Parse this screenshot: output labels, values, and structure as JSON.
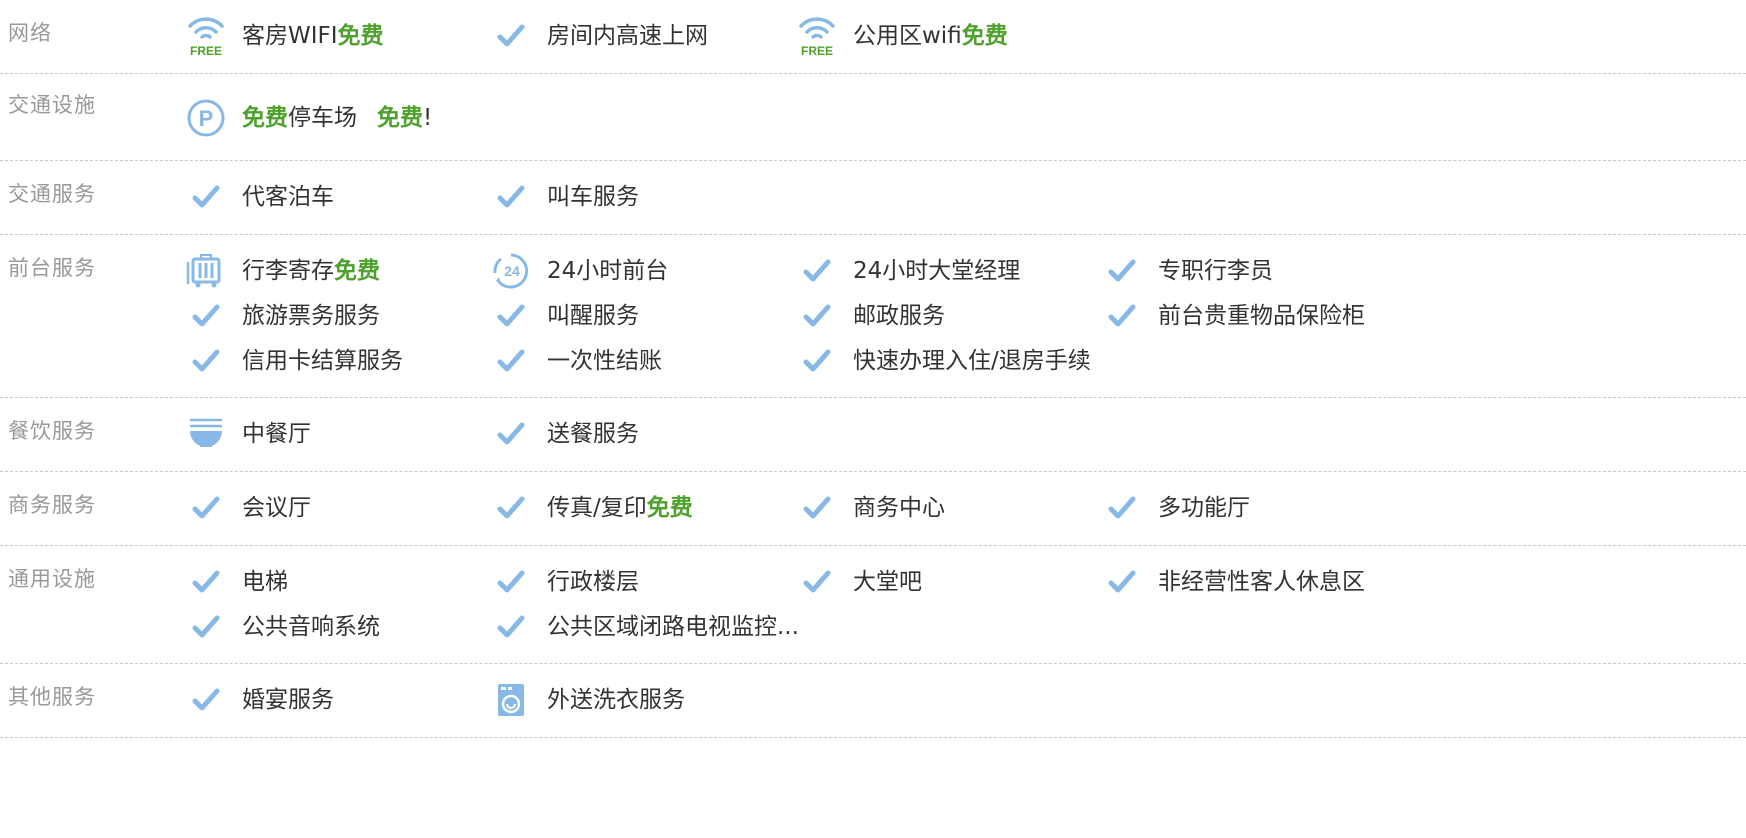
{
  "colors": {
    "accent_blue": "#88b9e6",
    "free_green": "#4ea12c",
    "category_gray": "#999999",
    "text": "#333333",
    "divider": "#c8c8c8"
  },
  "rows": [
    {
      "category": "网络",
      "items": [
        {
          "icon": "wifi-free-icon",
          "icon_text": "FREE",
          "label": "客房WIFI",
          "free": "免费"
        },
        {
          "icon": "check-icon",
          "label": "房间内高速上网"
        },
        {
          "icon": "wifi-free-icon",
          "icon_text": "FREE",
          "label": "公用区wifi",
          "free": "免费"
        }
      ]
    },
    {
      "category": "交通设施",
      "items": [
        {
          "icon": "parking-icon",
          "icon_text": "P",
          "free": "免费",
          "label": "停车场",
          "free2": "免费",
          "suffix": "!"
        }
      ]
    },
    {
      "category": "交通服务",
      "items": [
        {
          "icon": "check-icon",
          "label": "代客泊车"
        },
        {
          "icon": "check-icon",
          "label": "叫车服务"
        }
      ]
    },
    {
      "category": "前台服务",
      "items": [
        {
          "icon": "luggage-icon",
          "label": "行李寄存",
          "free": "免费"
        },
        {
          "icon": "24h-icon",
          "icon_text": "24",
          "label": "24小时前台"
        },
        {
          "icon": "check-icon",
          "label": "24小时大堂经理"
        },
        {
          "icon": "check-icon",
          "label": "专职行李员"
        },
        {
          "icon": "check-icon",
          "label": "旅游票务服务"
        },
        {
          "icon": "check-icon",
          "label": "叫醒服务"
        },
        {
          "icon": "check-icon",
          "label": "邮政服务"
        },
        {
          "icon": "check-icon",
          "label": "前台贵重物品保险柜"
        },
        {
          "icon": "check-icon",
          "label": "信用卡结算服务"
        },
        {
          "icon": "check-icon",
          "label": "一次性结账"
        },
        {
          "icon": "check-icon",
          "label": "快速办理入住/退房手续"
        }
      ]
    },
    {
      "category": "餐饮服务",
      "items": [
        {
          "icon": "bowl-icon",
          "label": "中餐厅"
        },
        {
          "icon": "check-icon",
          "label": "送餐服务"
        }
      ]
    },
    {
      "category": "商务服务",
      "items": [
        {
          "icon": "check-icon",
          "label": "会议厅"
        },
        {
          "icon": "check-icon",
          "label": "传真/复印",
          "free": "免费"
        },
        {
          "icon": "check-icon",
          "label": "商务中心"
        },
        {
          "icon": "check-icon",
          "label": "多功能厅"
        }
      ]
    },
    {
      "category": "通用设施",
      "items": [
        {
          "icon": "check-icon",
          "label": "电梯"
        },
        {
          "icon": "check-icon",
          "label": "行政楼层"
        },
        {
          "icon": "check-icon",
          "label": "大堂吧"
        },
        {
          "icon": "check-icon",
          "label": "非经营性客人休息区"
        },
        {
          "icon": "check-icon",
          "label": "公共音响系统"
        },
        {
          "icon": "check-icon",
          "label": "公共区域闭路电视监控..."
        }
      ]
    },
    {
      "category": "其他服务",
      "items": [
        {
          "icon": "check-icon",
          "label": "婚宴服务"
        },
        {
          "icon": "washer-icon",
          "label": "外送洗衣服务"
        }
      ]
    }
  ]
}
